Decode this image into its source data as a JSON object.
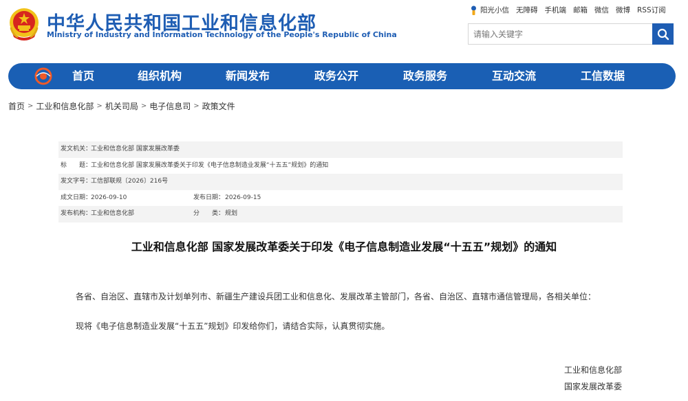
{
  "header": {
    "title": "中华人民共和国工业和信息化部",
    "subtitle": "Ministry of Industry and Information Technology of the People's Republic of China",
    "toplinks": [
      "阳光小信",
      "无障碍",
      "手机端",
      "邮箱",
      "微信",
      "微博",
      "RSS订阅"
    ],
    "search_placeholder": "请输入关键字"
  },
  "nav": {
    "items": [
      "首页",
      "组织机构",
      "新闻发布",
      "政务公开",
      "政务服务",
      "互动交流",
      "工信数据"
    ]
  },
  "breadcrumb": [
    "首页",
    "工业和信息化部",
    "机关司局",
    "电子信息司",
    "政策文件"
  ],
  "doc_info": {
    "issuer_label": "发文机关：",
    "issuer": "工业和信息化部 国家发展改革委",
    "title_label": "标　　题：",
    "title": "工业和信息化部 国家发展改革委关于印发《电子信息制造业发展“十五五”规划》的通知",
    "doc_no_label": "发文字号：",
    "doc_no": "工信部联规〔2026〕216号",
    "date_label": "成文日期：",
    "date": "2026-09-10",
    "pub_date_label": "发布日期：",
    "pub_date": "2026-09-15",
    "publisher_label": "发布机构：",
    "publisher": "工业和信息化部",
    "category_label": "分　　类：",
    "category": "规划"
  },
  "article": {
    "title": "工业和信息化部 国家发展改革委关于印发《电子信息制造业发展“十五五”规划》的通知",
    "recipients": "各省、自治区、直辖市及计划单列市、新疆生产建设兵团工业和信息化、发展改革主管部门，各省、自治区、直辖市通信管理局，各相关单位：",
    "body": "现将《电子信息制造业发展“十五五”规划》印发给你们，请结合实际，认真贯彻实施。",
    "signers": [
      "工业和信息化部",
      "国家发展改革委"
    ]
  },
  "colors": {
    "brand_blue": "#1e5db3",
    "nav_blue": "#1a5fb4",
    "emblem_red": "#d7261e",
    "emblem_gold": "#f2c21a"
  },
  "icons": {
    "emblem": "national-emblem-icon",
    "search": "search-icon",
    "care": "care-mode-icon",
    "nav_logo": "miit-logo-icon"
  }
}
